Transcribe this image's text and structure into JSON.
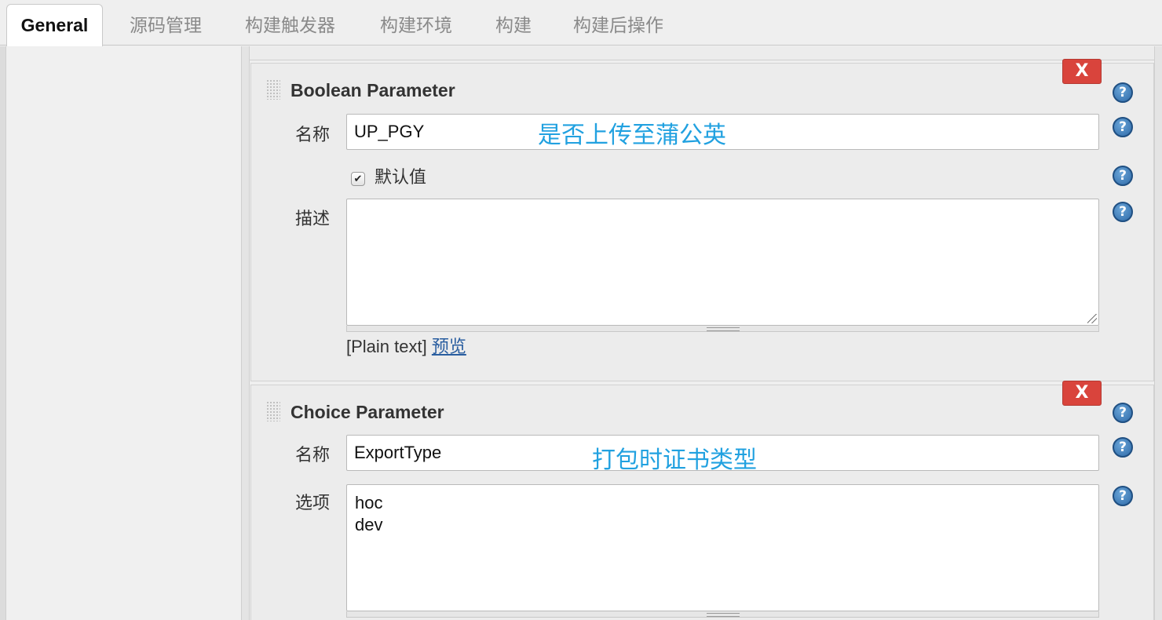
{
  "tabs": [
    "General",
    "源码管理",
    "构建触发器",
    "构建环境",
    "构建",
    "构建后操作"
  ],
  "boolean_param": {
    "title": "Boolean Parameter",
    "delete_label": "X",
    "name_label": "名称",
    "name_value": "UP_PGY",
    "name_annotation": "是否上传至蒲公英",
    "default_label": "默认值",
    "default_checked": true,
    "desc_label": "描述",
    "desc_value": "",
    "format_text": "[Plain text]",
    "preview_link": "预览"
  },
  "choice_param": {
    "title": "Choice Parameter",
    "delete_label": "X",
    "name_label": "名称",
    "name_value": "ExportType",
    "name_annotation": "打包时证书类型",
    "choices_label": "选项",
    "choices_value": "hoc\ndev"
  },
  "help_glyph": "?",
  "check_glyph": "✔",
  "colors": {
    "delete_button": "#d9443c",
    "help_icon": "#2e6aa8",
    "annotation": "#21a1e0",
    "link": "#2a5ea0"
  }
}
